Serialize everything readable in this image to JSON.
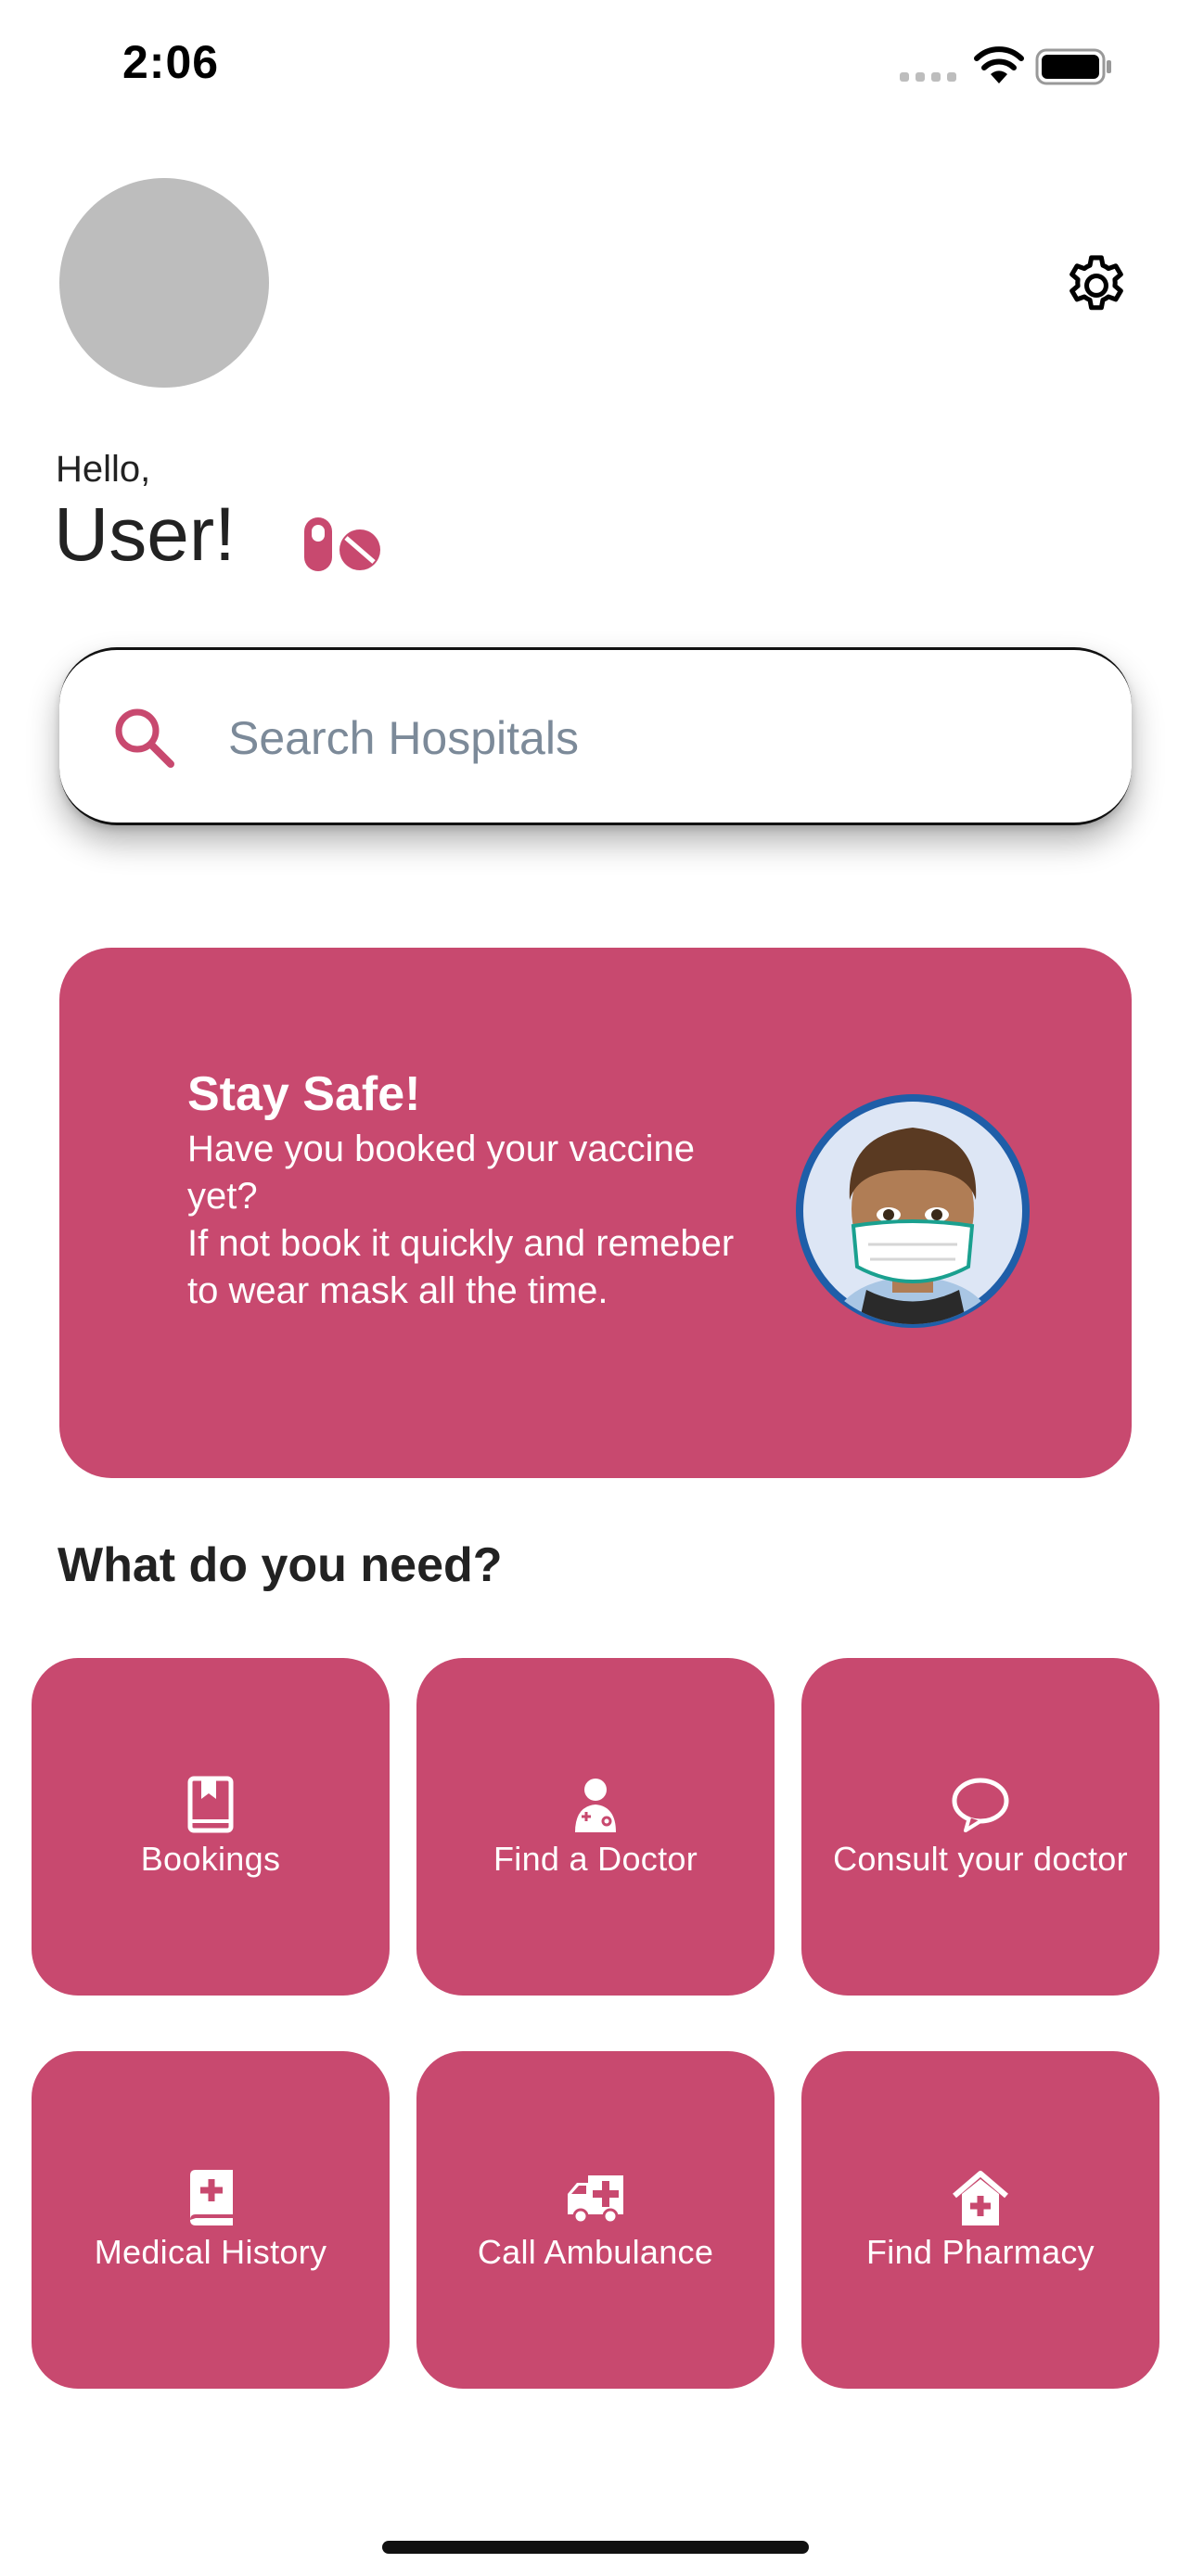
{
  "status_bar": {
    "time": "2:06"
  },
  "header": {
    "greeting": "Hello,",
    "username": "User!"
  },
  "search": {
    "placeholder": "Search Hospitals"
  },
  "banner": {
    "title": "Stay Safe!",
    "message": "Have you booked your vaccine yet?\nIf not book it quickly and remeber to wear mask all the time."
  },
  "section": {
    "title": "What do you need?"
  },
  "services": [
    {
      "label": "Bookings",
      "icon": "bookmark-book-icon"
    },
    {
      "label": "Find a Doctor",
      "icon": "doctor-icon"
    },
    {
      "label": "Consult your doctor",
      "icon": "chat-bubble-icon"
    },
    {
      "label": "Medical History",
      "icon": "medical-book-icon"
    },
    {
      "label": "Call Ambulance",
      "icon": "ambulance-icon"
    },
    {
      "label": "Find Pharmacy",
      "icon": "pharmacy-house-icon"
    }
  ],
  "colors": {
    "accent": "#c8496f",
    "avatar_placeholder": "#bdbdbd",
    "placeholder_text": "#7c8a99"
  }
}
